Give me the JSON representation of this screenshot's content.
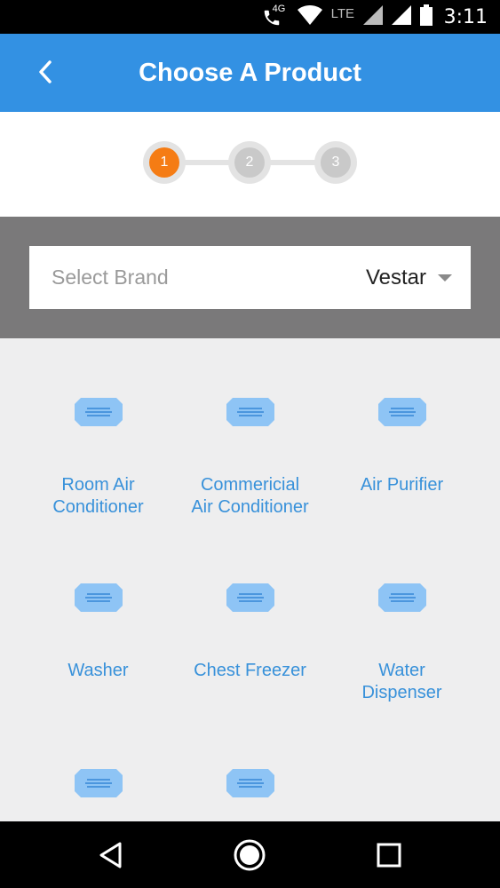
{
  "status_bar": {
    "network_tag": "4G",
    "lte_label": "LTE",
    "time": "3:11"
  },
  "app_bar": {
    "title": "Choose A Product",
    "back_icon": "back-arrow-icon"
  },
  "stepper": {
    "steps": [
      {
        "number": "1",
        "state": "active"
      },
      {
        "number": "2",
        "state": "inactive"
      },
      {
        "number": "3",
        "state": "inactive"
      }
    ],
    "active_color": "#f57c14",
    "inactive_color": "#c9c9c9"
  },
  "brand_selector": {
    "label": "Select Brand",
    "selected": "Vestar"
  },
  "products": [
    {
      "name": "Room Air\nConditioner",
      "icon": "air-conditioner-icon"
    },
    {
      "name": "Commericial\nAir Conditioner",
      "icon": "air-conditioner-icon"
    },
    {
      "name": "Air Purifier",
      "icon": "air-conditioner-icon"
    },
    {
      "name": "Washer",
      "icon": "air-conditioner-icon"
    },
    {
      "name": "Chest Freezer",
      "icon": "air-conditioner-icon"
    },
    {
      "name": "Water\nDispenser",
      "icon": "air-conditioner-icon"
    },
    {
      "name": "",
      "icon": "air-conditioner-icon"
    },
    {
      "name": "",
      "icon": "air-conditioner-icon"
    }
  ],
  "colors": {
    "app_bar": "#3391e3",
    "product_text": "#3891da",
    "brand_band": "#7a797a",
    "grid_background": "#eeeeef"
  },
  "nav_bar": {
    "back": "nav-back-icon",
    "home": "nav-home-icon",
    "recents": "nav-recents-icon"
  }
}
